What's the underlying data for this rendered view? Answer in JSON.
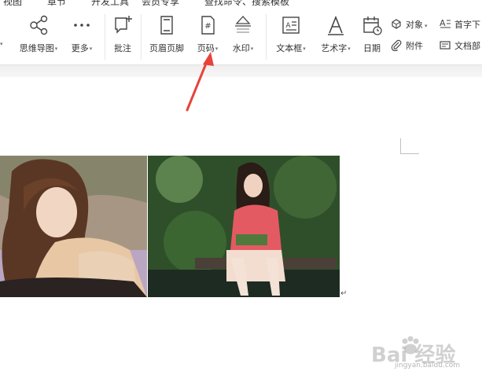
{
  "menubar": {
    "items": [
      "视图",
      "章节",
      "开发工具",
      "会员专享",
      "查找命令、搜索模板"
    ]
  },
  "ribbon": {
    "tools": [
      {
        "label": "思维导图",
        "icon": "mindmap-icon",
        "dropdown": true
      },
      {
        "label": "更多",
        "icon": "more-icon",
        "dropdown": true
      },
      {
        "label": "批注",
        "icon": "comment-icon",
        "dropdown": false
      },
      {
        "label": "页眉页脚",
        "icon": "header-footer-icon",
        "dropdown": false
      },
      {
        "label": "页码",
        "icon": "page-number-icon",
        "dropdown": true
      },
      {
        "label": "水印",
        "icon": "watermark-icon",
        "dropdown": true
      },
      {
        "label": "文本框",
        "icon": "textbox-icon",
        "dropdown": true
      },
      {
        "label": "艺术字",
        "icon": "wordart-icon",
        "dropdown": true
      },
      {
        "label": "日期",
        "icon": "date-icon",
        "dropdown": false
      }
    ],
    "small_tools": [
      {
        "label": "对象",
        "icon": "object-icon",
        "dropdown": true
      },
      {
        "label": "附件",
        "icon": "attachment-icon",
        "dropdown": false
      },
      {
        "label": "首字下",
        "icon": "drop-cap-icon",
        "dropdown": false
      },
      {
        "label": "文档部",
        "icon": "doc-parts-icon",
        "dropdown": false
      }
    ],
    "page_number_glyph": "#",
    "accent_color": "#e8423b"
  },
  "document": {
    "paragraph_mark": "↵"
  },
  "watermark": {
    "main": "Bai 经验",
    "sub": "jingyan.baidu.com"
  }
}
